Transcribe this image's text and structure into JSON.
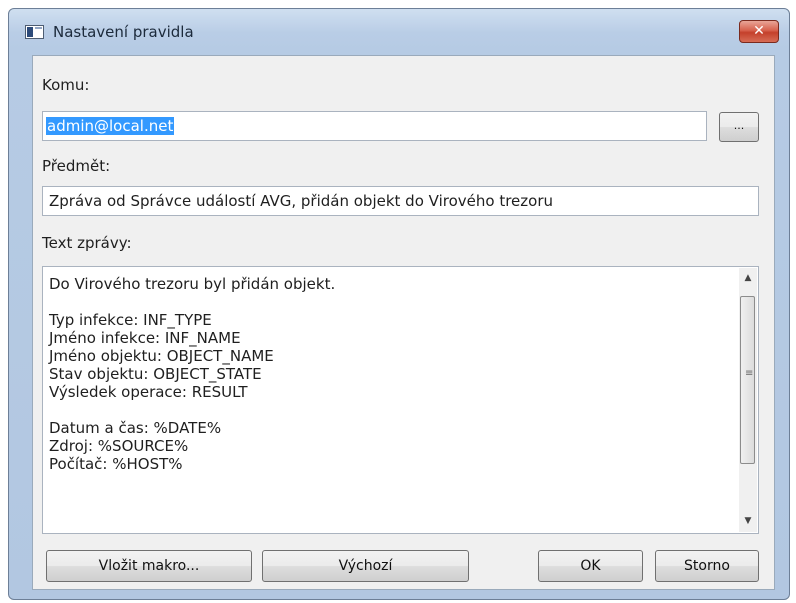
{
  "window": {
    "title": "Nastavení pravidla",
    "close_label": "✕"
  },
  "form": {
    "to_label": "Komu:",
    "to_value": "admin@local.net",
    "browse_label": "...",
    "subject_label": "Předmět:",
    "subject_value": "Zpráva od Správce událostí AVG, přidán objekt do Virového trezoru",
    "body_label": "Text zprávy:",
    "body_lines": [
      "Do Virového trezoru byl přidán objekt.",
      "",
      "Typ infekce: INF_TYPE",
      "Jméno infekce: INF_NAME",
      "Jméno objektu: OBJECT_NAME",
      "Stav objektu: OBJECT_STATE",
      "Výsledek operace: RESULT",
      "",
      "Datum a čas: %DATE%",
      "Zdroj: %SOURCE%",
      "Počítač: %HOST%"
    ]
  },
  "buttons": {
    "insert_macro": "Vložit makro...",
    "default": "Výchozí",
    "ok": "OK",
    "cancel": "Storno"
  },
  "icons": {
    "scroll_up": "scroll-up-arrow-icon",
    "scroll_down": "scroll-down-arrow-icon",
    "close": "close-icon",
    "app": "app-window-icon"
  },
  "colors": {
    "selection": "#3399ff",
    "close_button": "#c94f3a",
    "dialog_bg": "#f0f0f0"
  }
}
